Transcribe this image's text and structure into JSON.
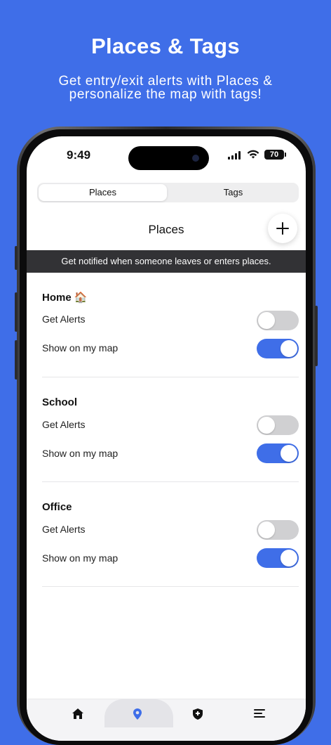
{
  "promo": {
    "title": "Places & Tags",
    "subtitle_line1": "Get entry/exit alerts with Places &",
    "subtitle_line2": "personalize the map with tags!"
  },
  "status_bar": {
    "time": "9:49",
    "battery": "70"
  },
  "tabs": [
    "Places",
    "Tags"
  ],
  "header": {
    "title": "Places",
    "add_icon": "plus-icon"
  },
  "banner": "Get notified when someone leaves or enters places.",
  "places": [
    {
      "name": "Home 🏠",
      "alerts_label": "Get Alerts",
      "alerts_on": false,
      "map_label": "Show on my map",
      "map_on": true
    },
    {
      "name": "School",
      "alerts_label": "Get Alerts",
      "alerts_on": false,
      "map_label": "Show on my map",
      "map_on": true
    },
    {
      "name": "Office",
      "alerts_label": "Get Alerts",
      "alerts_on": false,
      "map_label": "Show on my map",
      "map_on": true
    }
  ],
  "tab_bar": {
    "icons": [
      "home-icon",
      "location-pin-icon",
      "shield-icon",
      "menu-icon"
    ],
    "active": "location-pin-icon"
  },
  "colors": {
    "brand": "#3f6ee8",
    "banner": "#323235"
  }
}
